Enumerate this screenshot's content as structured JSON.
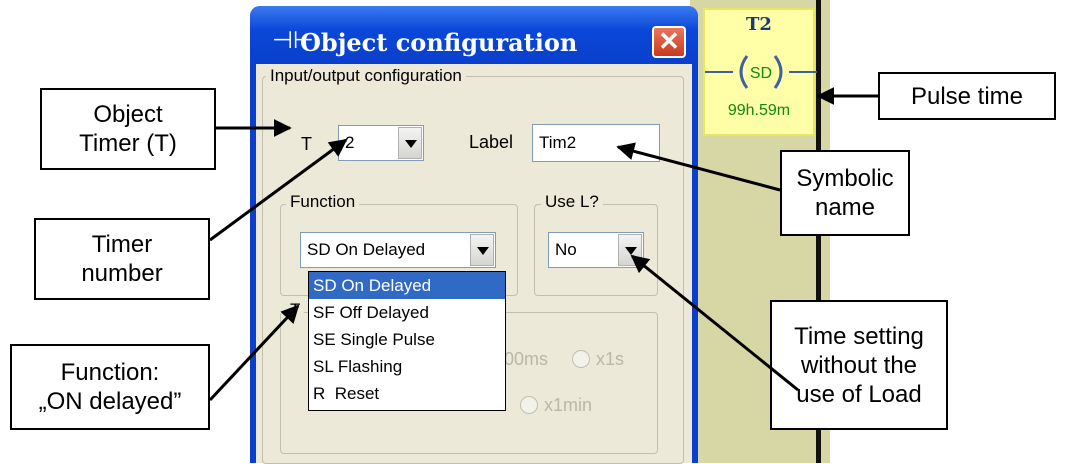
{
  "ladder": {
    "timer_title": "T2",
    "coil_label": "SD",
    "pulse_value": "99h.59m"
  },
  "dialog": {
    "title": "Object configuration",
    "title_icon": "contact-icon",
    "close_glyph": "✕",
    "io_group_label": "Input/output configuration",
    "t_label": "T",
    "t_value": "2",
    "label_label": "Label",
    "label_value": "Tim2",
    "function_group_label": "Function",
    "function_value": "SD On Delayed",
    "use_l_group_label": "Use L?",
    "use_l_value": "No",
    "function_options": [
      "SD On Delayed",
      "SF Off Delayed",
      "SE Single Pulse",
      "SL Flashing",
      "R  Reset"
    ],
    "selected_option": "SD On Delayed",
    "time_group_label_partial": "T",
    "radio_100ms": "00ms",
    "radio_1s": "x1s",
    "radio_1min": "x1min"
  },
  "callouts": {
    "object_timer": "Object\nTimer (T)",
    "timer_number": "Timer\nnumber",
    "function_on_delayed": "Function:\n„ON delayed”",
    "pulse_time": "Pulse time",
    "symbolic_name": "Symbolic\nname",
    "time_setting": "Time setting\nwithout the\nuse of Load"
  },
  "colors": {
    "title_bar": "#0a47d8",
    "close_button": "#d9532f",
    "selection": "#316ac5",
    "ladder_bg": "#d7d7a6",
    "timer_text": "#118811"
  }
}
